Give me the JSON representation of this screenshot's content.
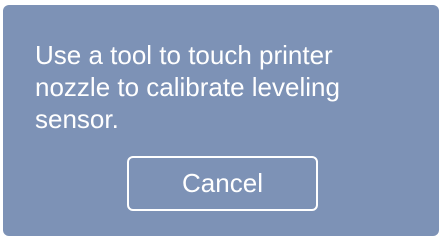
{
  "dialog": {
    "message": "Use a tool to touch printer\nnozzle to calibrate leveling\n sensor.",
    "cancel_label": "Cancel"
  },
  "colors": {
    "dialog_background": "#7d92b6",
    "text": "#ffffff",
    "button_border": "#ffffff"
  }
}
